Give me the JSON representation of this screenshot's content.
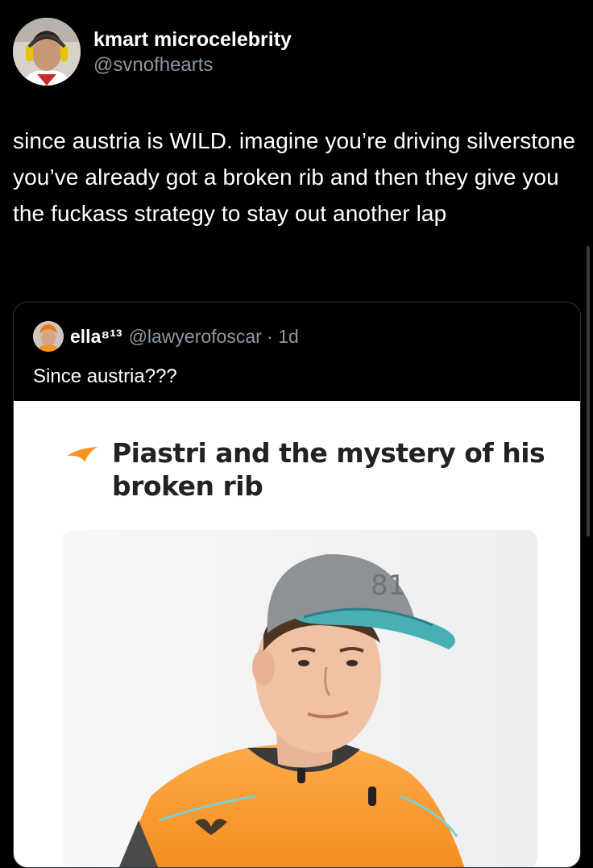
{
  "author": {
    "display_name": "kmart microcelebrity",
    "handle": "@svnofhearts"
  },
  "tweet": {
    "text": "since austria is WILD. imagine you’re driving silverstone you’ve already got a broken rib and then they give you the fuckass strategy to stay out another lap"
  },
  "quote": {
    "display_name": "ella⁸¹³",
    "handle": "@lawyerofoscar · 1d",
    "text": "Since austria???",
    "article": {
      "headline": "Piastri and the mystery of his broken rib",
      "cap_number": "81"
    }
  },
  "colors": {
    "background": "#000000",
    "secondary_text": "#8b98a5",
    "papaya": "#f7931e",
    "border": "#2f3336"
  },
  "icons": {
    "swoosh": "mclaren-swoosh-icon"
  }
}
